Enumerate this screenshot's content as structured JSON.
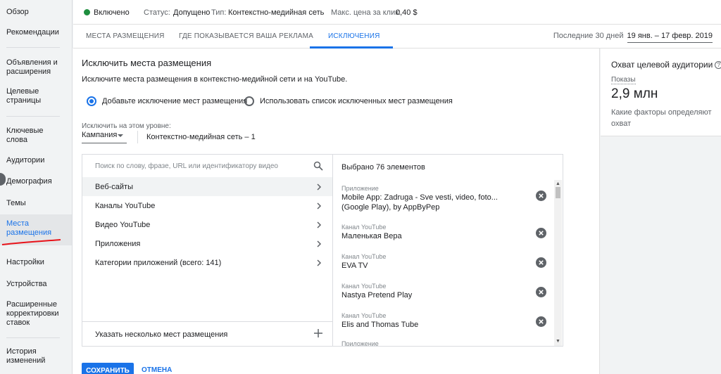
{
  "sidebar": {
    "items": [
      {
        "label": "Обзор"
      },
      {
        "label": "Рекомендации"
      },
      {
        "label": "Объявления и расширения"
      },
      {
        "label": "Целевые страницы"
      },
      {
        "label": "Ключевые слова"
      },
      {
        "label": "Аудитории"
      },
      {
        "label": "Демография"
      },
      {
        "label": "Темы"
      },
      {
        "label": "Места размещения",
        "active": true
      },
      {
        "label": "Настройки"
      },
      {
        "label": "Устройства"
      },
      {
        "label": "Расширенные корректировки ставок"
      },
      {
        "label": "История изменений"
      }
    ]
  },
  "status": {
    "state": "Включено",
    "status_label": "Статус:",
    "status_value": "Допущено",
    "type_label": "Тип:",
    "type_value": "Контекстно-медийная сеть",
    "max_cpc_label": "Макс. цена за клик:",
    "max_cpc_value": "0,40 $",
    "state_color": "#1e8e3e"
  },
  "tabs": [
    {
      "label": "МЕСТА РАЗМЕЩЕНИЯ"
    },
    {
      "label": "ГДЕ ПОКАЗЫВАЕТСЯ ВАША РЕКЛАМА"
    },
    {
      "label": "ИСКЛЮЧЕНИЯ",
      "active": true
    }
  ],
  "date": {
    "label": "Последние 30 дней",
    "range": "19 янв. – 17 февр. 2019"
  },
  "exclude": {
    "title": "Исключить места размещения",
    "subtitle": "Исключите места размещения в контекстно-медийной сети и на YouTube.",
    "radio_add": "Добавьте исключение мест размещения",
    "radio_list": "Использовать список исключенных мест размещения",
    "level_label": "Исключить на этом уровне:",
    "level_select": "Кампания",
    "level_value": "Контекстно-медийная сеть – 1"
  },
  "search": {
    "placeholder": "Поиск по слову, фразе, URL или идентификатору видео"
  },
  "categories": [
    {
      "label": "Веб-сайты"
    },
    {
      "label": "Каналы YouTube"
    },
    {
      "label": "Видео YouTube"
    },
    {
      "label": "Приложения"
    },
    {
      "label": "Категории приложений (всего: 141)"
    }
  ],
  "add_multiple": "Указать несколько мест размещения",
  "selected": {
    "header": "Выбрано 76 элементов",
    "items": [
      {
        "type": "Приложение",
        "name": "Mobile App: Zadruga - Sve vesti, video, foto... (Google Play), by AppByPep"
      },
      {
        "type": "Канал YouTube",
        "name": "Маленькая Вера"
      },
      {
        "type": "Канал YouTube",
        "name": "EVA TV"
      },
      {
        "type": "Канал YouTube",
        "name": "Nastya Pretend Play"
      },
      {
        "type": "Канал YouTube",
        "name": "Elis and Thomas Tube"
      },
      {
        "type": "Приложение",
        "name": ""
      }
    ]
  },
  "actions": {
    "save": "СОХРАНИТЬ",
    "cancel": "ОТМЕНА"
  },
  "reach": {
    "title": "Охват целевой аудитории",
    "metric_label": "Показы",
    "metric_value": "2,9 млн",
    "link": "Какие факторы определяют охват"
  },
  "colors": {
    "accent": "#1a73e8",
    "annotation": "#e8131a"
  }
}
